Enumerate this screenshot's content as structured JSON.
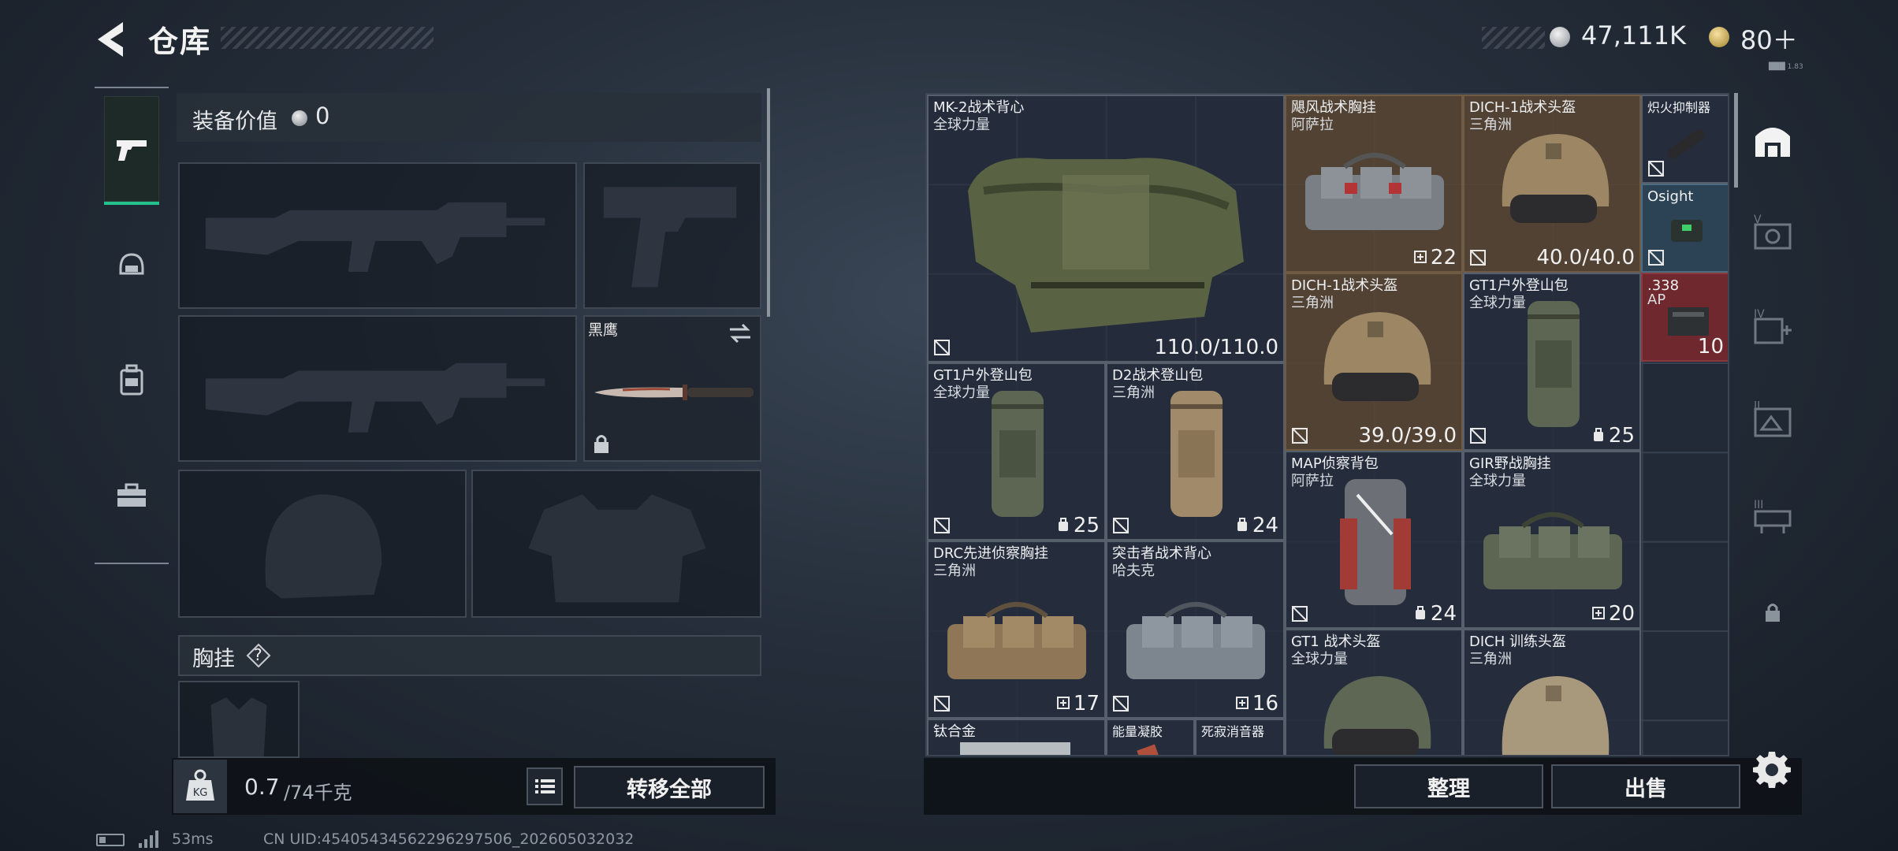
{
  "header": {
    "title": "仓库",
    "money": "47,111K",
    "tickets": "80＋",
    "tiny": "███ 1.83"
  },
  "left_nav": {
    "items": [
      {
        "icon": "pistol-icon",
        "active": true
      },
      {
        "icon": "helmet-icon"
      },
      {
        "icon": "backpack-icon"
      },
      {
        "icon": "toolbox-icon"
      }
    ]
  },
  "loadout": {
    "equip_value_label": "装备价值",
    "equip_value": "0",
    "knife_name": "黑鹰",
    "chest_rig_label": "胸挂",
    "chest_rig_help": "?",
    "weight": "0.7",
    "weight_max": "/74千克",
    "transfer_all": "转移全部"
  },
  "items": [
    {
      "name": "MK-2战术背心",
      "sub": "全球力量",
      "value": "110.0/110.0",
      "theme": "",
      "icon": "armor-vest-icon"
    },
    {
      "name": "飓风战术胸挂",
      "sub": "阿萨拉",
      "value": "22",
      "theme": "brown",
      "icon": "chest-rig-icon"
    },
    {
      "name": "DICH-1战术头盔",
      "sub": "三角洲",
      "value": "40.0/40.0",
      "theme": "brown",
      "icon": "helmet-icon"
    },
    {
      "name": "炽火抑制器",
      "sub": "",
      "value": "",
      "theme": "",
      "icon": "suppressor-icon"
    },
    {
      "name": "Osight",
      "sub": "",
      "value": "",
      "theme": "blue",
      "icon": "optic-sight-icon"
    },
    {
      "name": "DICH-1战术头盔",
      "sub": "三角洲",
      "value": "39.0/39.0",
      "theme": "brown",
      "icon": "helmet-icon"
    },
    {
      "name": "GT1户外登山包",
      "sub": "全球力量",
      "value": "25",
      "theme": "",
      "icon": "backpack-icon"
    },
    {
      "name": ".338",
      "sub": "AP",
      "value": "10",
      "theme": "red",
      "icon": "ammo-box-icon"
    },
    {
      "name": "GT1户外登山包",
      "sub": "全球力量",
      "value": "25",
      "theme": "",
      "icon": "backpack-icon"
    },
    {
      "name": "D2战术登山包",
      "sub": "三角洲",
      "value": "24",
      "theme": "",
      "icon": "backpack-icon"
    },
    {
      "name": "MAP侦察背包",
      "sub": "阿萨拉",
      "value": "24",
      "theme": "",
      "icon": "backpack-icon"
    },
    {
      "name": "GIR野战胸挂",
      "sub": "全球力量",
      "value": "20",
      "theme": "",
      "icon": "chest-rig-icon"
    },
    {
      "name": "DRC先进侦察胸挂",
      "sub": "三角洲",
      "value": "17",
      "theme": "",
      "icon": "chest-rig-icon"
    },
    {
      "name": "突击者战术背心",
      "sub": "哈夫克",
      "value": "16",
      "theme": "",
      "icon": "chest-rig-icon"
    },
    {
      "name": "GT1 战术头盔",
      "sub": "全球力量",
      "value": "",
      "theme": "",
      "icon": "helmet-icon"
    },
    {
      "name": "DICH 训练头盔",
      "sub": "三角洲",
      "value": "",
      "theme": "",
      "icon": "helmet-icon"
    },
    {
      "name": "钛合金",
      "sub": "",
      "value": "",
      "theme": "",
      "icon": "metal-plate-icon"
    },
    {
      "name": "能量凝胶",
      "sub": "",
      "value": "",
      "theme": "",
      "icon": "gel-icon"
    },
    {
      "name": "死寂消音器",
      "sub": "",
      "value": "",
      "theme": "",
      "icon": "suppressor-icon"
    }
  ],
  "right_categories": [
    {
      "icon": "all-items-icon",
      "active": true
    },
    {
      "label": "V",
      "icon": "cat-v-icon"
    },
    {
      "label": "IV",
      "icon": "cat-iv-icon"
    },
    {
      "label": "II",
      "icon": "cat-ii-icon"
    },
    {
      "label": "III",
      "icon": "cat-iii-icon"
    },
    {
      "icon": "lock-icon"
    }
  ],
  "actions": {
    "sort": "整理",
    "sell": "出售"
  },
  "status": {
    "ping": "53ms",
    "uid": "CN UID:4540543456229629750​6_202605032032"
  }
}
